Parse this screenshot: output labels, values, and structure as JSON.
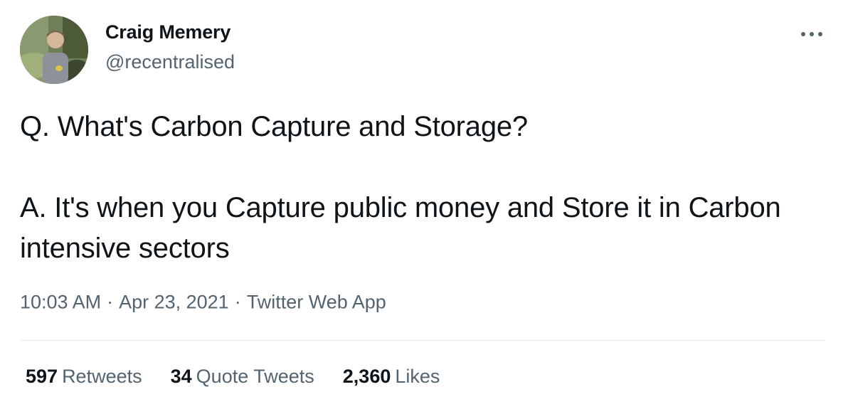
{
  "author": {
    "name": "Craig Memery",
    "handle": "@recentralised"
  },
  "tweet": {
    "line1": "Q. What's Carbon Capture and Storage?",
    "line2": "A. It's when you Capture public money and Store it in Carbon intensive sectors"
  },
  "meta": {
    "time": "10:03 AM",
    "separator": "·",
    "date": "Apr 23, 2021",
    "source": "Twitter Web App"
  },
  "stats": {
    "retweets": {
      "count": "597",
      "label": "Retweets"
    },
    "quotes": {
      "count": "34",
      "label": "Quote Tweets"
    },
    "likes": {
      "count": "2,360",
      "label": "Likes"
    }
  },
  "colors": {
    "text": "#0f1419",
    "secondary": "#536471",
    "divider": "#e6ecf0"
  },
  "icons": {
    "more": "more-horizontal-icon"
  }
}
